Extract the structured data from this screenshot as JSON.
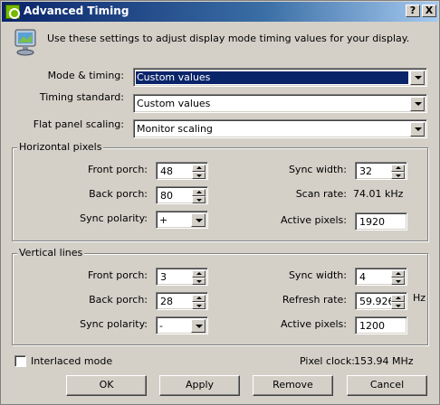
{
  "window": {
    "title": "Advanced Timing",
    "help_label": "?",
    "close_label": "X"
  },
  "intro": "Use these settings to adjust display mode timing values for your display.",
  "mode_timing": {
    "label": "Mode & timing:",
    "value": "Custom values"
  },
  "timing_standard": {
    "label": "Timing standard:",
    "value": "Custom values"
  },
  "flat_panel_scaling": {
    "label": "Flat panel scaling:",
    "value": "Monitor scaling"
  },
  "horizontal": {
    "title": "Horizontal pixels",
    "front_porch": {
      "label": "Front porch:",
      "value": "48"
    },
    "back_porch": {
      "label": "Back porch:",
      "value": "80"
    },
    "sync_polarity": {
      "label": "Sync polarity:",
      "value": "+"
    },
    "sync_width": {
      "label": "Sync width:",
      "value": "32"
    },
    "scan_rate": {
      "label": "Scan rate:",
      "value": "74.01 kHz"
    },
    "active_pixels": {
      "label": "Active pixels:",
      "value": "1920"
    }
  },
  "vertical": {
    "title": "Vertical lines",
    "front_porch": {
      "label": "Front porch:",
      "value": "3"
    },
    "back_porch": {
      "label": "Back porch:",
      "value": "28"
    },
    "sync_polarity": {
      "label": "Sync polarity:",
      "value": "-"
    },
    "sync_width": {
      "label": "Sync width:",
      "value": "4"
    },
    "refresh_rate": {
      "label": "Refresh rate:",
      "value": "59.926",
      "unit": "Hz"
    },
    "active_pixels": {
      "label": "Active pixels:",
      "value": "1200"
    }
  },
  "interlaced": {
    "label": "Interlaced mode",
    "checked": false
  },
  "pixel_clock": {
    "label": "Pixel clock:",
    "value": "153.94 MHz"
  },
  "buttons": {
    "ok": "OK",
    "apply": "Apply",
    "remove": "Remove",
    "cancel": "Cancel"
  },
  "icons": {
    "app": "nvidia-logo-icon",
    "monitor": "monitor-icon"
  }
}
